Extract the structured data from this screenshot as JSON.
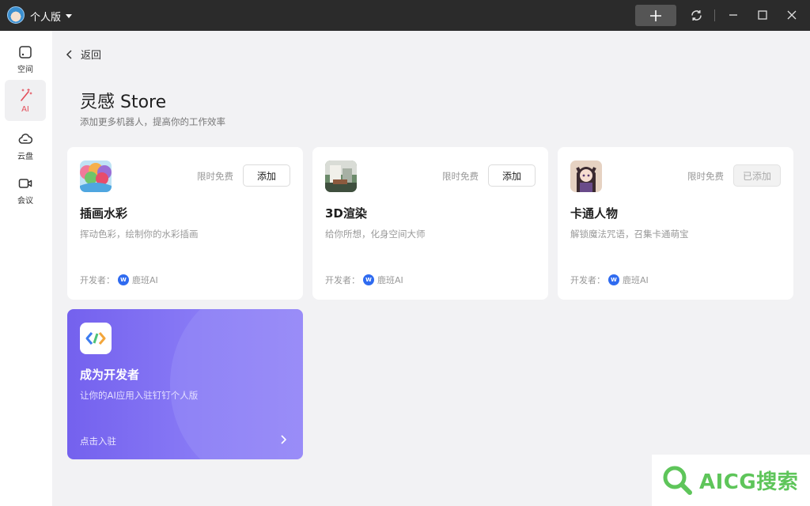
{
  "titlebar": {
    "edition": "个人版",
    "icons": [
      "plus-icon",
      "sync-icon",
      "minimize-icon",
      "maximize-icon",
      "close-icon"
    ]
  },
  "sidebar": {
    "items": [
      {
        "label": "空间",
        "icon": "space-icon"
      },
      {
        "label": "AI",
        "icon": "magic-wand-icon",
        "active": true
      },
      {
        "label": "云盘",
        "icon": "cloud-icon"
      },
      {
        "label": "会议",
        "icon": "video-icon"
      }
    ],
    "active_color": "#e34d59"
  },
  "main": {
    "back_label": "返回",
    "title": "灵感 Store",
    "subtitle": "添加更多机器人，提高你的工作效率",
    "developer_prefix": "开发者：",
    "cards": [
      {
        "name": "插画水彩",
        "desc": "挥动色彩，绘制你的水彩插画",
        "badge": "限时免费",
        "button": "添加",
        "added": false,
        "developer": "鹿班AI"
      },
      {
        "name": "3D渲染",
        "desc": "给你所想，化身空间大师",
        "badge": "限时免费",
        "button": "添加",
        "added": false,
        "developer": "鹿班AI"
      },
      {
        "name": "卡通人物",
        "desc": "解锁魔法咒语，召集卡通萌宝",
        "badge": "限时免费",
        "button": "已添加",
        "added": true,
        "developer": "鹿班AI"
      }
    ],
    "dev_card": {
      "title": "成为开发者",
      "desc": "让你的AI应用入驻钉钉个人版",
      "cta": "点击入驻"
    }
  },
  "watermark": {
    "text": "AICG搜索"
  }
}
